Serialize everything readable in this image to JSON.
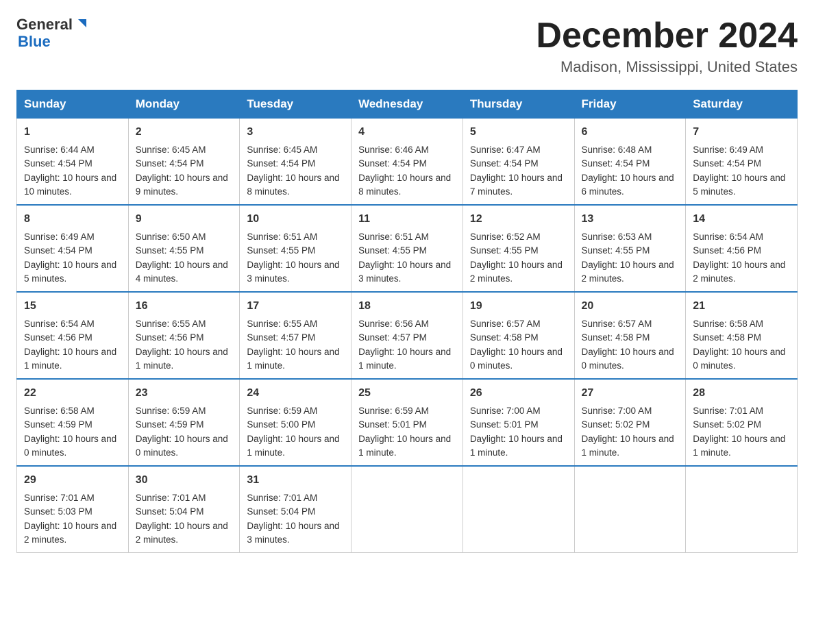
{
  "header": {
    "logo_line1": "General",
    "logo_line2": "Blue",
    "month_title": "December 2024",
    "location": "Madison, Mississippi, United States"
  },
  "weekdays": [
    "Sunday",
    "Monday",
    "Tuesday",
    "Wednesday",
    "Thursday",
    "Friday",
    "Saturday"
  ],
  "weeks": [
    [
      {
        "day": "1",
        "sunrise": "6:44 AM",
        "sunset": "4:54 PM",
        "daylight": "10 hours and 10 minutes."
      },
      {
        "day": "2",
        "sunrise": "6:45 AM",
        "sunset": "4:54 PM",
        "daylight": "10 hours and 9 minutes."
      },
      {
        "day": "3",
        "sunrise": "6:45 AM",
        "sunset": "4:54 PM",
        "daylight": "10 hours and 8 minutes."
      },
      {
        "day": "4",
        "sunrise": "6:46 AM",
        "sunset": "4:54 PM",
        "daylight": "10 hours and 8 minutes."
      },
      {
        "day": "5",
        "sunrise": "6:47 AM",
        "sunset": "4:54 PM",
        "daylight": "10 hours and 7 minutes."
      },
      {
        "day": "6",
        "sunrise": "6:48 AM",
        "sunset": "4:54 PM",
        "daylight": "10 hours and 6 minutes."
      },
      {
        "day": "7",
        "sunrise": "6:49 AM",
        "sunset": "4:54 PM",
        "daylight": "10 hours and 5 minutes."
      }
    ],
    [
      {
        "day": "8",
        "sunrise": "6:49 AM",
        "sunset": "4:54 PM",
        "daylight": "10 hours and 5 minutes."
      },
      {
        "day": "9",
        "sunrise": "6:50 AM",
        "sunset": "4:55 PM",
        "daylight": "10 hours and 4 minutes."
      },
      {
        "day": "10",
        "sunrise": "6:51 AM",
        "sunset": "4:55 PM",
        "daylight": "10 hours and 3 minutes."
      },
      {
        "day": "11",
        "sunrise": "6:51 AM",
        "sunset": "4:55 PM",
        "daylight": "10 hours and 3 minutes."
      },
      {
        "day": "12",
        "sunrise": "6:52 AM",
        "sunset": "4:55 PM",
        "daylight": "10 hours and 2 minutes."
      },
      {
        "day": "13",
        "sunrise": "6:53 AM",
        "sunset": "4:55 PM",
        "daylight": "10 hours and 2 minutes."
      },
      {
        "day": "14",
        "sunrise": "6:54 AM",
        "sunset": "4:56 PM",
        "daylight": "10 hours and 2 minutes."
      }
    ],
    [
      {
        "day": "15",
        "sunrise": "6:54 AM",
        "sunset": "4:56 PM",
        "daylight": "10 hours and 1 minute."
      },
      {
        "day": "16",
        "sunrise": "6:55 AM",
        "sunset": "4:56 PM",
        "daylight": "10 hours and 1 minute."
      },
      {
        "day": "17",
        "sunrise": "6:55 AM",
        "sunset": "4:57 PM",
        "daylight": "10 hours and 1 minute."
      },
      {
        "day": "18",
        "sunrise": "6:56 AM",
        "sunset": "4:57 PM",
        "daylight": "10 hours and 1 minute."
      },
      {
        "day": "19",
        "sunrise": "6:57 AM",
        "sunset": "4:58 PM",
        "daylight": "10 hours and 0 minutes."
      },
      {
        "day": "20",
        "sunrise": "6:57 AM",
        "sunset": "4:58 PM",
        "daylight": "10 hours and 0 minutes."
      },
      {
        "day": "21",
        "sunrise": "6:58 AM",
        "sunset": "4:58 PM",
        "daylight": "10 hours and 0 minutes."
      }
    ],
    [
      {
        "day": "22",
        "sunrise": "6:58 AM",
        "sunset": "4:59 PM",
        "daylight": "10 hours and 0 minutes."
      },
      {
        "day": "23",
        "sunrise": "6:59 AM",
        "sunset": "4:59 PM",
        "daylight": "10 hours and 0 minutes."
      },
      {
        "day": "24",
        "sunrise": "6:59 AM",
        "sunset": "5:00 PM",
        "daylight": "10 hours and 1 minute."
      },
      {
        "day": "25",
        "sunrise": "6:59 AM",
        "sunset": "5:01 PM",
        "daylight": "10 hours and 1 minute."
      },
      {
        "day": "26",
        "sunrise": "7:00 AM",
        "sunset": "5:01 PM",
        "daylight": "10 hours and 1 minute."
      },
      {
        "day": "27",
        "sunrise": "7:00 AM",
        "sunset": "5:02 PM",
        "daylight": "10 hours and 1 minute."
      },
      {
        "day": "28",
        "sunrise": "7:01 AM",
        "sunset": "5:02 PM",
        "daylight": "10 hours and 1 minute."
      }
    ],
    [
      {
        "day": "29",
        "sunrise": "7:01 AM",
        "sunset": "5:03 PM",
        "daylight": "10 hours and 2 minutes."
      },
      {
        "day": "30",
        "sunrise": "7:01 AM",
        "sunset": "5:04 PM",
        "daylight": "10 hours and 2 minutes."
      },
      {
        "day": "31",
        "sunrise": "7:01 AM",
        "sunset": "5:04 PM",
        "daylight": "10 hours and 3 minutes."
      },
      {
        "day": "",
        "sunrise": "",
        "sunset": "",
        "daylight": ""
      },
      {
        "day": "",
        "sunrise": "",
        "sunset": "",
        "daylight": ""
      },
      {
        "day": "",
        "sunrise": "",
        "sunset": "",
        "daylight": ""
      },
      {
        "day": "",
        "sunrise": "",
        "sunset": "",
        "daylight": ""
      }
    ]
  ],
  "labels": {
    "sunrise_prefix": "Sunrise: ",
    "sunset_prefix": "Sunset: ",
    "daylight_prefix": "Daylight: "
  }
}
